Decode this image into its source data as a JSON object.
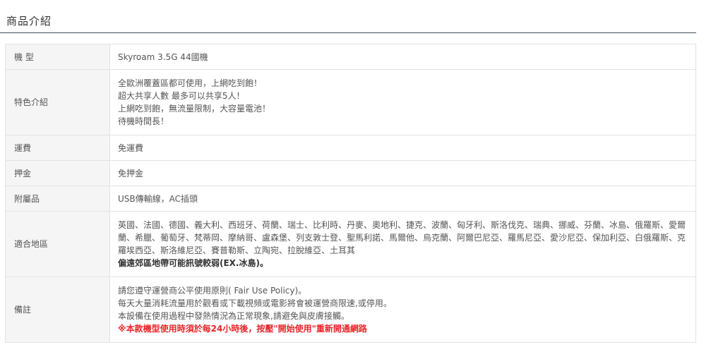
{
  "section": {
    "title": "商品介紹"
  },
  "spec_rows": {
    "model": {
      "label": "機 型",
      "value": "Skyroam 3.5G  44國機"
    },
    "features": {
      "label": "特色介紹",
      "lines": [
        "全歐洲覆蓋區都可使用，上網吃到飽！",
        "超大共享人數 最多可以共享5人！",
        "上網吃到飽，無流量限制，大容量電池！",
        "待機時間長！"
      ]
    },
    "shipping": {
      "label": "運費",
      "value": "免運費"
    },
    "deposit": {
      "label": "押金",
      "value": "免押金"
    },
    "accessories": {
      "label": "附屬品",
      "value": "USB傳輸線，AC插頭"
    },
    "regions": {
      "label": "適合地區",
      "countries": "英國、法國、德國、義大利、西班牙、荷蘭、瑞士、比利時、丹麥、奧地利、捷克、波蘭、匈牙利、斯洛伐克、瑞典、挪威、芬蘭、冰島、俄羅斯、愛爾蘭、希臘、葡萄牙、梵蒂岡、摩納哥、盧森堡、列支敦士登、聖馬利諾、馬爾他、烏克蘭、阿爾巴尼亞、羅馬尼亞、愛沙尼亞、保加利亞、白俄羅斯、克羅埃西亞、斯洛維尼亞、賽普勒斯、立陶宛、拉脫維亞、土耳其",
      "warning": "偏遠郊區地帶可能訊號較弱(EX.冰島)。"
    },
    "notes": {
      "label": "備註",
      "lines": [
        "請您遵守運營商公平使用原則( Fair Use Policy)。",
        "每天大量消耗流量用於觀看或下載視頻或電影將會被運營商限速,或停用。",
        "本設備在使用過程中發熱情況為正常現象,請避免與皮膚接觸。"
      ],
      "highlight": "※本款機型使用時須於每24小時後，按壓\"開始使用\"重新開通網路"
    }
  },
  "colors": {
    "title_rule": "#3f4d5a",
    "label_bg": "#f5f5f5",
    "border": "#e3e3e3",
    "highlight_red": "#e8262a"
  }
}
